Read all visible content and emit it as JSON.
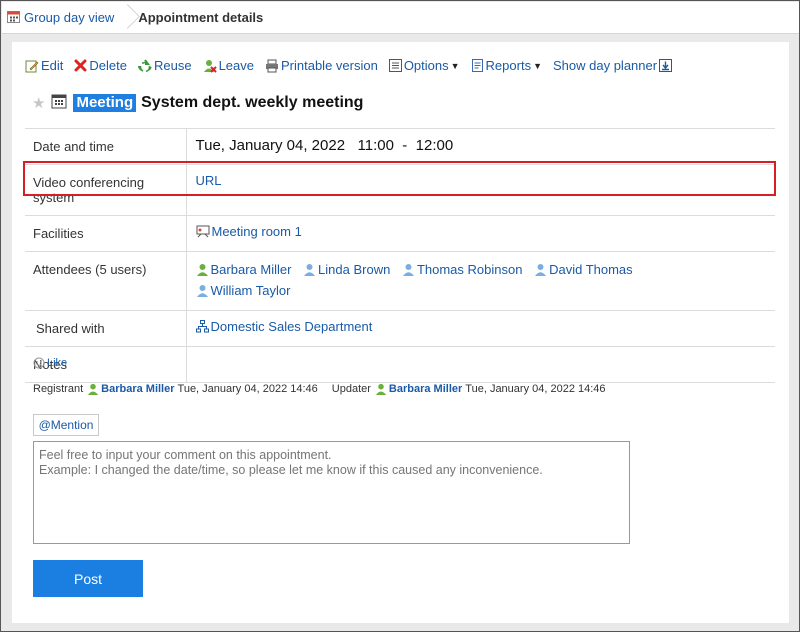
{
  "breadcrumb": {
    "home": "Group day view",
    "current": "Appointment details"
  },
  "toolbar": {
    "edit": "Edit",
    "delete": "Delete",
    "reuse": "Reuse",
    "leave": "Leave",
    "printable": "Printable version",
    "options": "Options",
    "reports": "Reports",
    "day_planner": "Show day planner"
  },
  "appointment": {
    "badge": "Meeting",
    "title": "System dept. weekly meeting"
  },
  "details": {
    "date_label": "Date and time",
    "date_value": "Tue, January 04, 2022   11:00  -  12:00",
    "video_label": "Video conferencing system",
    "video_value": "URL",
    "facilities_label": "Facilities",
    "facility": "Meeting room 1",
    "attendees_label": "Attendees (5 users)",
    "attendees": [
      "Barbara Miller",
      "Linda Brown",
      "Thomas Robinson",
      "David Thomas",
      "William Taylor"
    ],
    "shared_label": "Shared with",
    "shared_value": "Domestic Sales Department",
    "notes_label": "Notes",
    "notes_value": ""
  },
  "like": "Like",
  "meta": {
    "registrant_label": "Registrant",
    "registrant": "Barbara Miller",
    "registrant_time": "Tue, January 04, 2022 14:46",
    "updater_label": "Updater",
    "updater": "Barbara Miller",
    "updater_time": "Tue, January 04, 2022 14:46"
  },
  "mention": "@Mention",
  "comment_placeholder": "Feel free to input your comment on this appointment.\nExample: I changed the date/time, so please let me know if this caused any inconvenience.",
  "post": "Post",
  "colors": {
    "link": "#1a5aa6",
    "accent": "#1a7fe0",
    "highlight": "#d61e25"
  }
}
